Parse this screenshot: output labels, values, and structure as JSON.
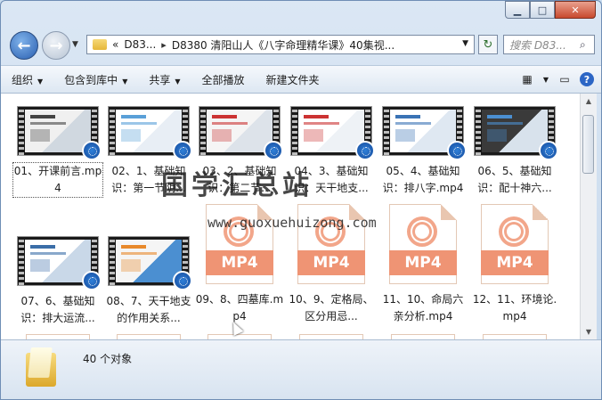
{
  "window": {
    "buttons": {
      "minimize": "▁",
      "maximize": "□",
      "close": "✕"
    }
  },
  "nav": {
    "back_icon": "arrow-left-icon",
    "forward_icon": "arrow-right-icon",
    "address_prefix": "«",
    "address_crumb1": "D83...",
    "address_crumb2": "D8380 清阳山人《八字命理精华课》40集视...",
    "search_placeholder": "搜索 D83..."
  },
  "toolbar": {
    "organize": "组织",
    "include_library": "包含到库中",
    "share": "共享",
    "play_all": "全部播放",
    "new_folder": "新建文件夹"
  },
  "files": [
    {
      "name": "01、开课前言.mp4",
      "thumb": "video",
      "colors": [
        "#f0f0f0",
        "#444",
        "#d0d8e0"
      ]
    },
    {
      "name": "02、1、基础知识：第一节阴...",
      "thumb": "video",
      "colors": [
        "#ffffff",
        "#5aa0d8",
        "#e8eef5"
      ]
    },
    {
      "name": "03、2、基础知识：第二节...",
      "thumb": "video",
      "colors": [
        "#f5f5f5",
        "#cc3333",
        "#dde3ea"
      ]
    },
    {
      "name": "04、3、基础知识：天干地支...",
      "thumb": "video",
      "colors": [
        "#ffffff",
        "#c33",
        "#eef2f6"
      ]
    },
    {
      "name": "05、4、基础知识：排八字.mp4",
      "thumb": "video",
      "colors": [
        "#ffffff",
        "#3a73b5",
        "#dfe8f2"
      ]
    },
    {
      "name": "06、5、基础知识：配十神六...",
      "thumb": "video",
      "colors": [
        "#3a3a3a",
        "#4b8fd1",
        "#d8e2ec"
      ]
    },
    {
      "name": "07、6、基础知识：排大运流...",
      "thumb": "video",
      "colors": [
        "#ffffff",
        "#3b6ea8",
        "#c9d8e8"
      ]
    },
    {
      "name": "08、7、天干地支的作用关系...",
      "thumb": "video",
      "colors": [
        "#f5f5f5",
        "#e8892b",
        "#4b8fd1"
      ]
    },
    {
      "name": "09、8、四墓库.mp4",
      "thumb": "mp4"
    },
    {
      "name": "10、9、定格局、区分用忌...",
      "thumb": "mp4"
    },
    {
      "name": "11、10、命局六亲分析.mp4",
      "thumb": "mp4"
    },
    {
      "name": "12、11、环境论.mp4",
      "thumb": "mp4"
    }
  ],
  "mp4_label": "MP4",
  "status": {
    "count_text": "40 个对象"
  },
  "watermark": {
    "cn": "国学汇总站",
    "url": "www.guoxuehuizong.com"
  }
}
